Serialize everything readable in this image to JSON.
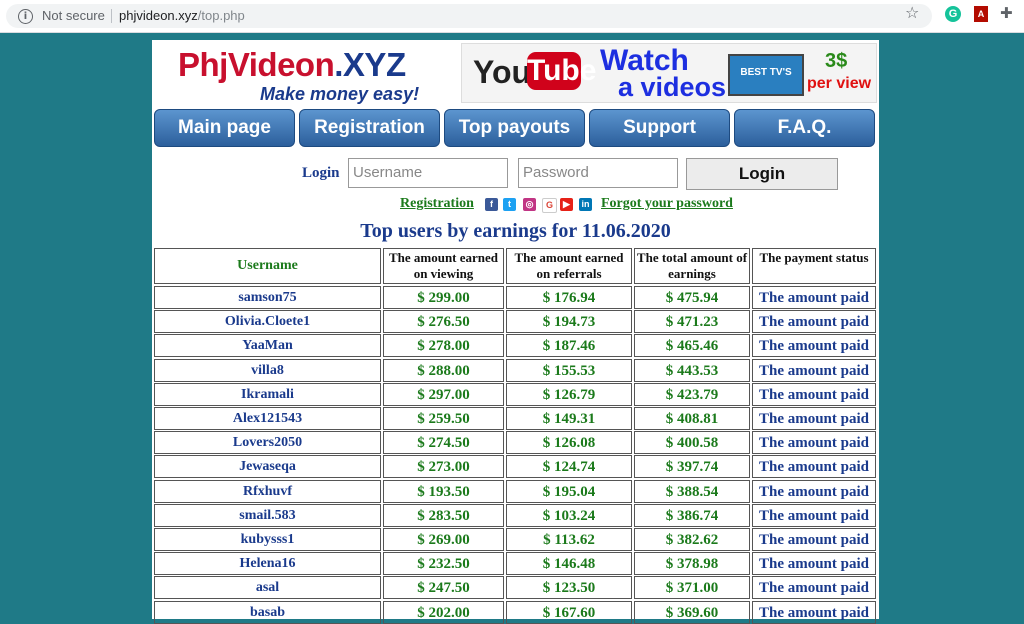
{
  "browser": {
    "security_label": "Not secure",
    "url_host": "phjvideon.xyz",
    "url_path": "/top.php"
  },
  "site": {
    "logo_text_red": "PhjVideon",
    "logo_text_blue": ".XYZ",
    "tagline": "Make money easy!",
    "banner": {
      "you": "You",
      "tube": "Tube",
      "watch": "Watch",
      "videos": "a videos",
      "tv_label": "BEST TV'S",
      "price": "3$",
      "per_view": "per view"
    }
  },
  "nav": {
    "items": [
      "Main page",
      "Registration",
      "Top payouts",
      "Support",
      "F.A.Q."
    ]
  },
  "login": {
    "label": "Login",
    "username_placeholder": "Username",
    "password_placeholder": "Password",
    "button": "Login"
  },
  "links": {
    "registration": "Registration",
    "forgot": "Forgot your password"
  },
  "social_icons": [
    "facebook-icon",
    "twitter-icon",
    "instagram-icon",
    "google-icon",
    "youtube-icon",
    "linkedin-icon"
  ],
  "heading": "Top users by earnings for 11.06.2020",
  "table": {
    "headers": [
      "Username",
      "The amount earned on viewing",
      "The amount earned on referrals",
      "The total amount of earnings",
      "The payment status"
    ],
    "rows": [
      [
        "samson75",
        "$ 299.00",
        "$ 176.94",
        "$ 475.94",
        "The amount paid"
      ],
      [
        "Olivia.Cloete1",
        "$ 276.50",
        "$ 194.73",
        "$ 471.23",
        "The amount paid"
      ],
      [
        "YaaMan",
        "$ 278.00",
        "$ 187.46",
        "$ 465.46",
        "The amount paid"
      ],
      [
        "villa8",
        "$ 288.00",
        "$ 155.53",
        "$ 443.53",
        "The amount paid"
      ],
      [
        "Ikramali",
        "$ 297.00",
        "$ 126.79",
        "$ 423.79",
        "The amount paid"
      ],
      [
        "Alex121543",
        "$ 259.50",
        "$ 149.31",
        "$ 408.81",
        "The amount paid"
      ],
      [
        "Lovers2050",
        "$ 274.50",
        "$ 126.08",
        "$ 400.58",
        "The amount paid"
      ],
      [
        "Jewaseqa",
        "$ 273.00",
        "$ 124.74",
        "$ 397.74",
        "The amount paid"
      ],
      [
        "Rfxhuvf",
        "$ 193.50",
        "$ 195.04",
        "$ 388.54",
        "The amount paid"
      ],
      [
        "smail.583",
        "$ 283.50",
        "$ 103.24",
        "$ 386.74",
        "The amount paid"
      ],
      [
        "kubysss1",
        "$ 269.00",
        "$ 113.62",
        "$ 382.62",
        "The amount paid"
      ],
      [
        "Helena16",
        "$ 232.50",
        "$ 146.48",
        "$ 378.98",
        "The amount paid"
      ],
      [
        "asal",
        "$ 247.50",
        "$ 123.50",
        "$ 371.00",
        "The amount paid"
      ],
      [
        "basab",
        "$ 202.00",
        "$ 167.60",
        "$ 369.60",
        "The amount paid"
      ]
    ]
  },
  "colors": {
    "page_background": "#1f7a87",
    "link_green": "#1b7a1b",
    "text_blue": "#1a3a8c",
    "nav_blue": "#2c5f9c"
  }
}
